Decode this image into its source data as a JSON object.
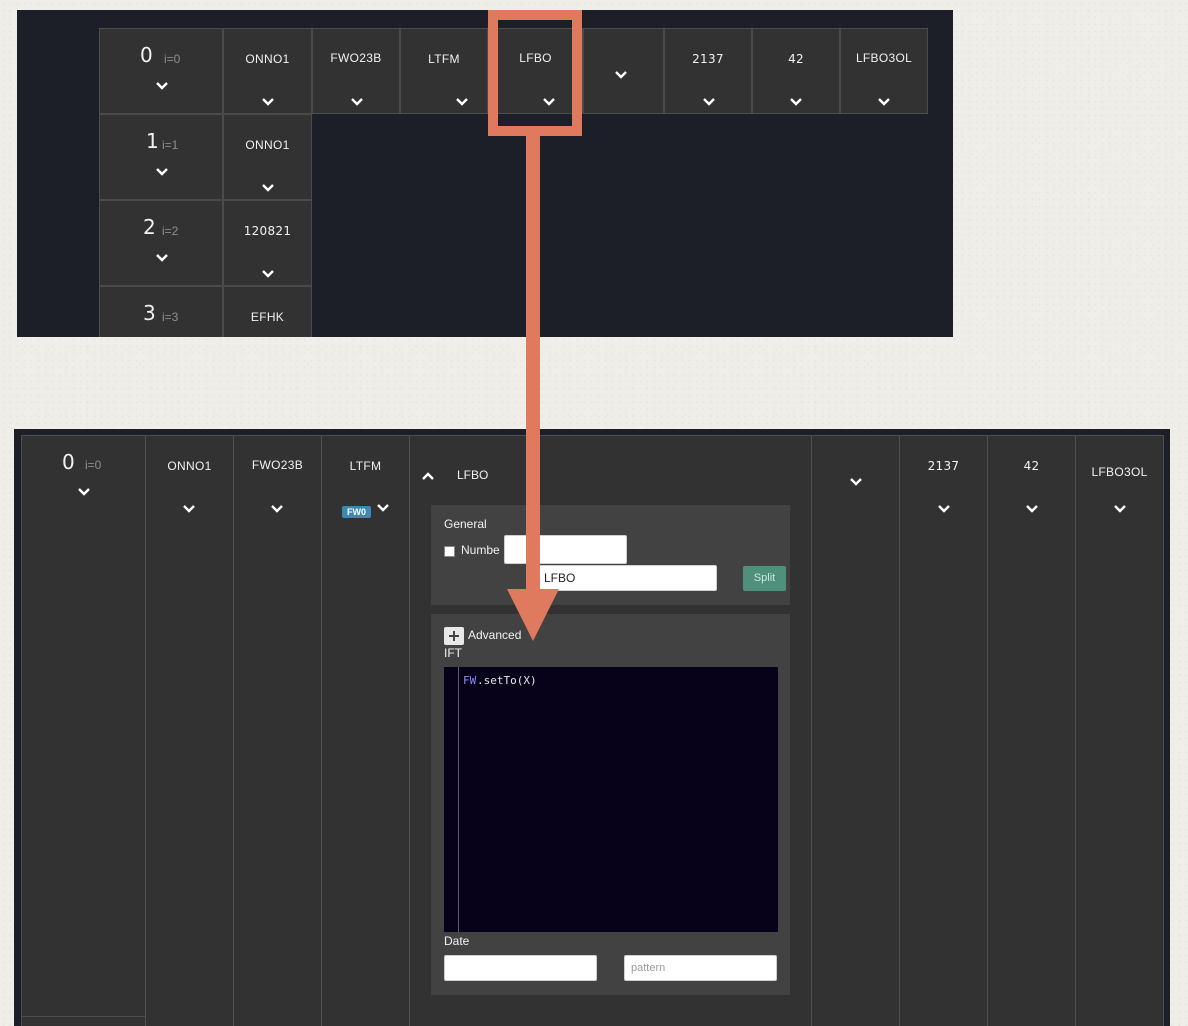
{
  "top_grid": {
    "header": {
      "row_number": "0",
      "row_index": "i=0",
      "columns": [
        "ONNO1",
        "FWO23B",
        "LTFM",
        "LFBO",
        "",
        "2137",
        "42",
        "LFBO3OL"
      ]
    },
    "rows": [
      {
        "number": "1",
        "index": "i=1",
        "value": "ONNO1"
      },
      {
        "number": "2",
        "index": "i=2",
        "value": "120821"
      },
      {
        "number": "3",
        "index": "i=3",
        "value": "EFHK"
      }
    ]
  },
  "expanded": {
    "header": {
      "row_number": "0",
      "row_index": "i=0",
      "col_onno": "ONNO1",
      "col_fwo": "FWO23B",
      "col_ltfm": "LTFM",
      "ltfm_badge": "FW0",
      "col_lfbo": "LFBO",
      "col_2137": "2137",
      "col_42": "42",
      "col_lfbo3ol": "LFBO3OL"
    },
    "general": {
      "title": "General",
      "checkbox_label": "Numbe",
      "number_value": "",
      "name_value": "LFBO",
      "split_label": "Split"
    },
    "advanced": {
      "toggle_label": "Advanced",
      "ift_label": "IFT",
      "code_keyword": "FW",
      "code_rest": ".setTo(X)",
      "date_label": "Date",
      "date_value": "",
      "pattern_placeholder": "pattern"
    }
  },
  "colors": {
    "panel_bg": "#1c1f27",
    "cell_bg": "#323232",
    "highlight": "#e07a5f",
    "badge": "#3d87b4",
    "split_button": "#4f8f7b",
    "code_bg": "#07011a",
    "code_keyword": "#8a8cff"
  },
  "icons": [
    "chevron-down-icon",
    "chevron-up-icon",
    "plus-icon",
    "checkbox"
  ]
}
